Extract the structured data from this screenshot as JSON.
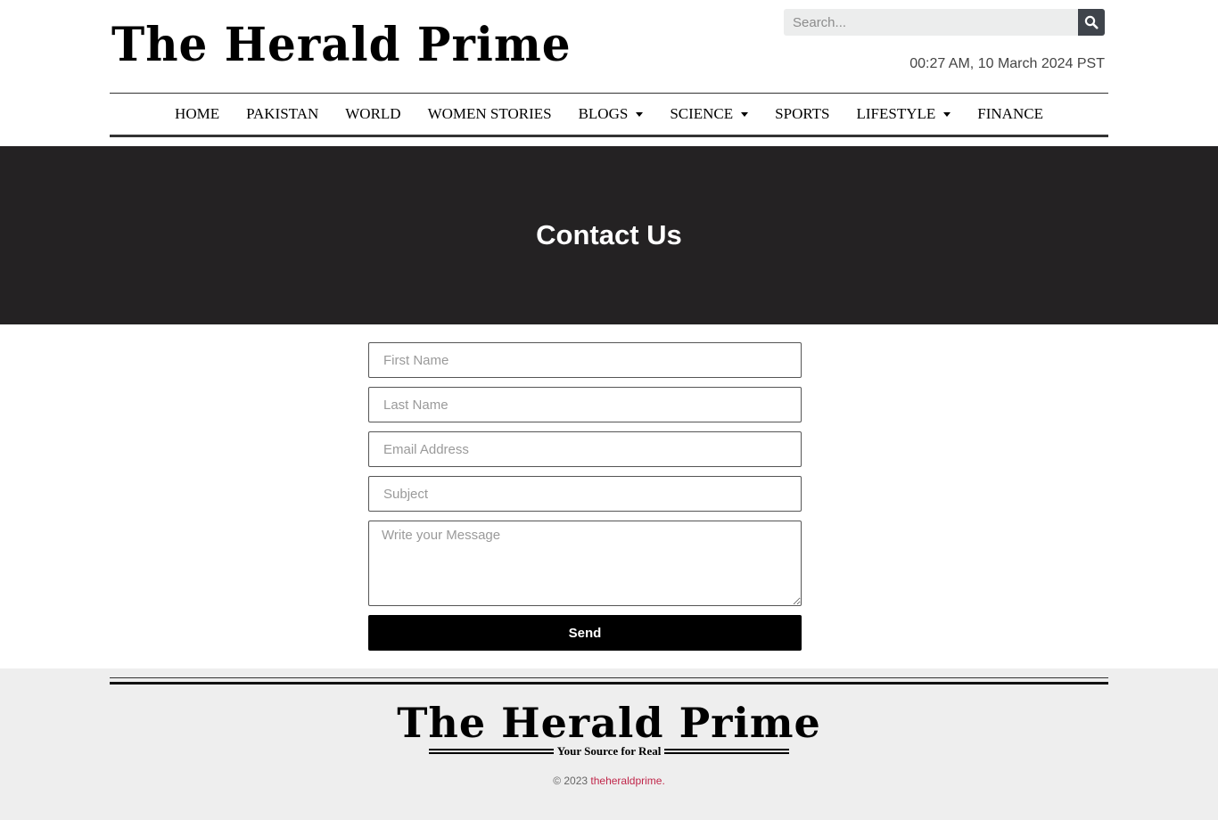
{
  "header": {
    "logo_text": "The Herald Prime",
    "search_placeholder": "Search...",
    "datetime": "00:27 AM, 10 March 2024 PST"
  },
  "nav": {
    "items": [
      {
        "label": "HOME",
        "dropdown": false
      },
      {
        "label": "PAKISTAN",
        "dropdown": false
      },
      {
        "label": "WORLD",
        "dropdown": false
      },
      {
        "label": "WOMEN STORIES",
        "dropdown": false
      },
      {
        "label": "BLOGS",
        "dropdown": true
      },
      {
        "label": "SCIENCE",
        "dropdown": true
      },
      {
        "label": "SPORTS",
        "dropdown": false
      },
      {
        "label": "LIFESTYLE",
        "dropdown": true
      },
      {
        "label": "FINANCE",
        "dropdown": false
      }
    ]
  },
  "banner": {
    "title": "Contact Us",
    "background_color": "#242223"
  },
  "form": {
    "first_name_placeholder": "First Name",
    "last_name_placeholder": "Last Name",
    "email_placeholder": "Email Address",
    "subject_placeholder": "Subject",
    "message_placeholder": "Write your Message",
    "send_label": "Send"
  },
  "footer": {
    "logo_text": "The Herald Prime",
    "tagline": "Your Source for Real",
    "copyright_prefix": "© 2023",
    "copyright_link": "theheraldprime.",
    "link_color": "#c0264a"
  }
}
